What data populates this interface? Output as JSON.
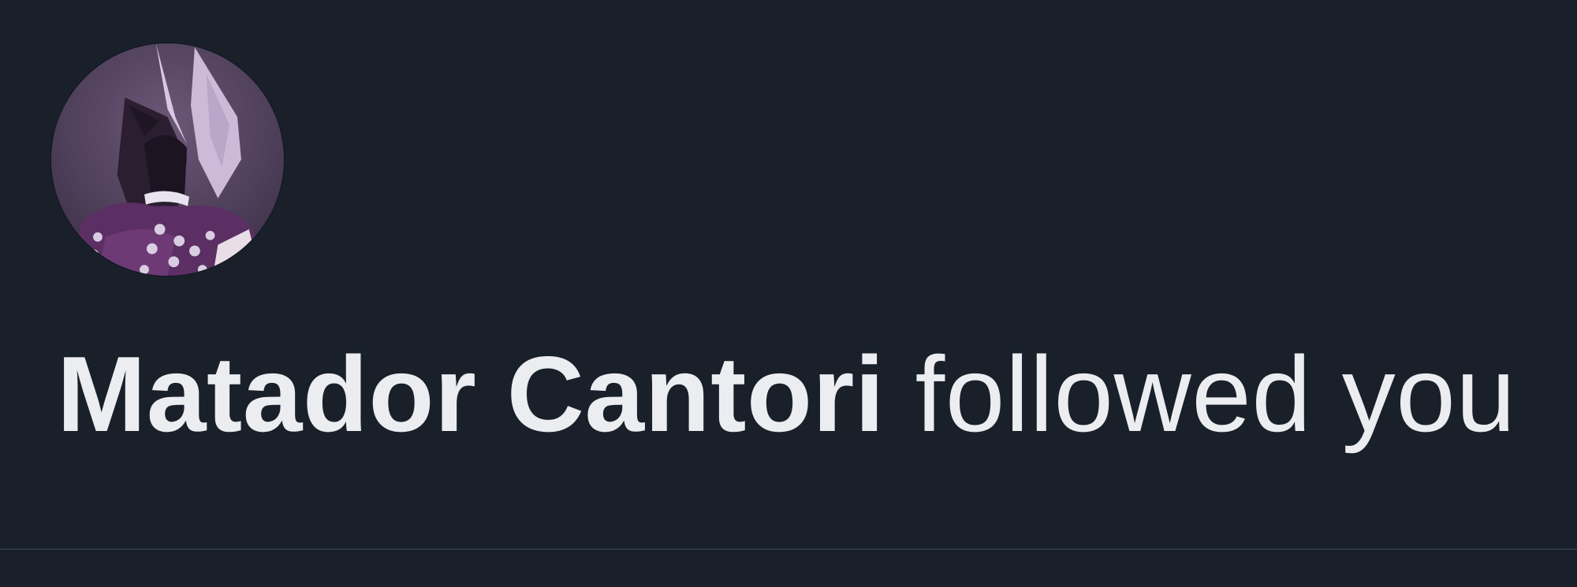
{
  "notification": {
    "type": "follow",
    "user_name": "Matador Cantori",
    "action_text": " followed you"
  },
  "colors": {
    "background": "#19202a",
    "text": "#ecedf1",
    "divider": "#2c3643"
  },
  "icons": {
    "avatar": "user-avatar-image"
  }
}
